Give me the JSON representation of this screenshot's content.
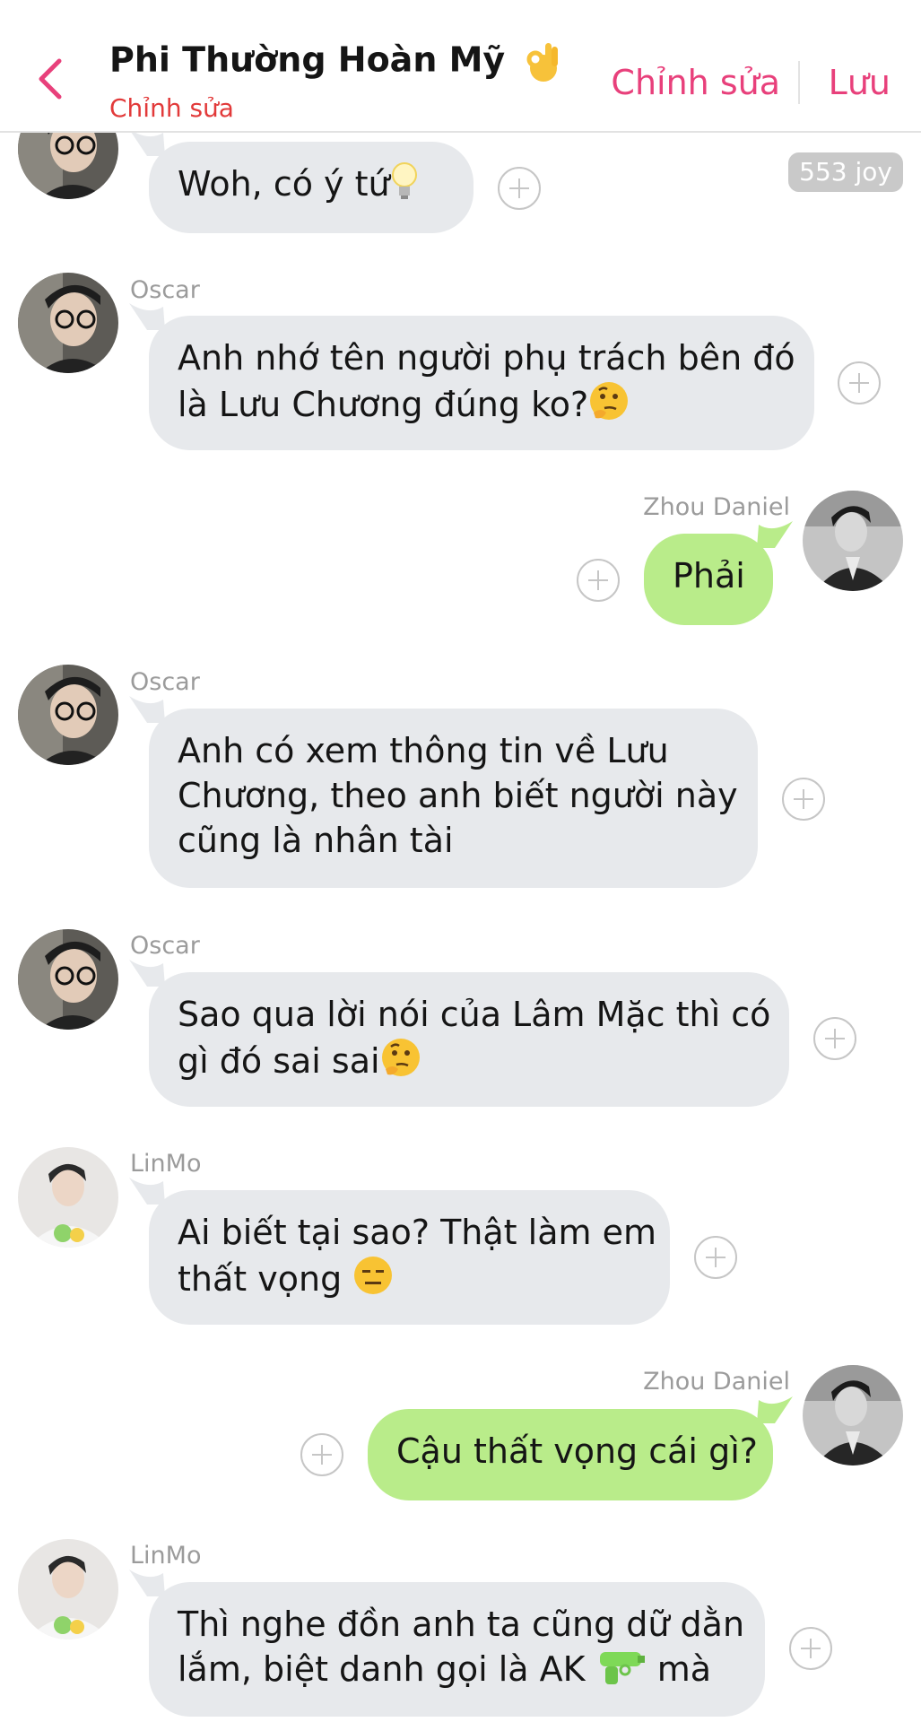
{
  "header": {
    "title": "Phi Thường Hoàn Mỹ",
    "subtitle": "Chỉnh sửa",
    "edit_label": "Chỉnh sửa",
    "save_label": "Lưu",
    "accent_color": "#e8407b",
    "subtitle_color": "#e23a3a",
    "title_icon": "ok-hand-emoji"
  },
  "joy_badge": "553 joy",
  "messages": [
    {
      "sender": "",
      "direction": "in",
      "lines": [
        "Woh,  có ý tứ"
      ],
      "emoji": "light-bulb-icon"
    },
    {
      "sender": "Oscar",
      "direction": "in",
      "lines": [
        "Anh nhớ tên người phụ trách bên đó",
        "là Lưu Chương đúng ko?"
      ],
      "emoji": "thinking-face-icon"
    },
    {
      "sender": "Zhou Daniel",
      "direction": "out",
      "lines": [
        "Phải"
      ]
    },
    {
      "sender": "Oscar",
      "direction": "in",
      "lines": [
        "Anh có xem thông tin về Lưu",
        "Chương, theo anh biết người này",
        "cũng là nhân tài"
      ]
    },
    {
      "sender": "Oscar",
      "direction": "in",
      "lines": [
        "Sao qua lời nói của Lâm Mặc thì có",
        "gì đó sai sai"
      ],
      "emoji": "thinking-face-icon"
    },
    {
      "sender": "LinMo",
      "direction": "in",
      "lines": [
        "Ai biết tại sao? Thật làm em",
        "thất vọng "
      ],
      "emoji": "expressionless-face-icon"
    },
    {
      "sender": "Zhou Daniel",
      "direction": "out",
      "lines": [
        "Cậu thất vọng cái gì?"
      ]
    },
    {
      "sender": "LinMo",
      "direction": "in",
      "lines": [
        "Thì nghe đồn anh ta cũng dữ dằn",
        "lắm, biệt danh gọi là AK ",
        " mà"
      ],
      "emoji": "water-pistol-icon"
    }
  ]
}
